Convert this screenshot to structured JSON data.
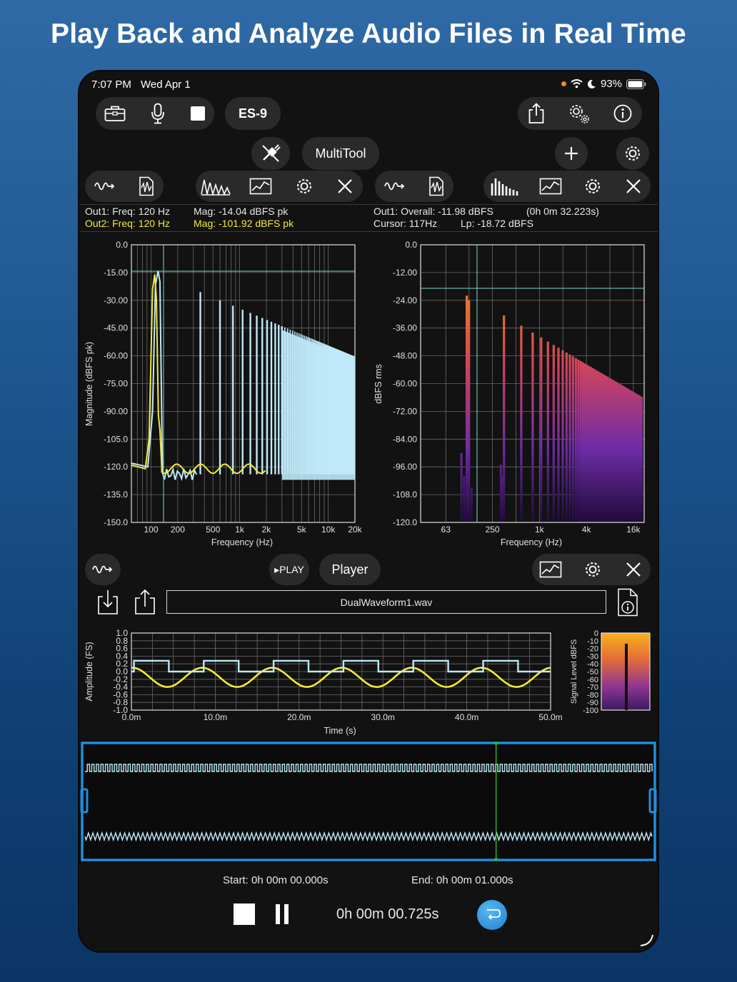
{
  "headline": "Play Back and Analyze Audio Files in Real Time",
  "status": {
    "time": "7:07 PM",
    "date": "Wed Apr 1",
    "battery": "93%"
  },
  "toolbar": {
    "device": "ES-9",
    "multitool": "MultiTool"
  },
  "fft": {
    "out1": "Out1:  Freq: 120 Hz",
    "out1_mag": "Mag: -14.04 dBFS pk",
    "out2": "Out2:  Freq: 120 Hz",
    "out2_mag": "Mag: -101.92 dBFS pk",
    "ylabel": "Magnitude (dBFS pk)",
    "xlabel": "Frequency (Hz)",
    "yticks": [
      "0.0",
      "-15.00",
      "-30.00",
      "-45.00",
      "-60.00",
      "-75.00",
      "-90.00",
      "-105.0",
      "-120.0",
      "-135.0",
      "-150.0"
    ],
    "xticks": [
      "100",
      "200",
      "500",
      "1k",
      "2k",
      "5k",
      "10k",
      "20k"
    ]
  },
  "rta": {
    "overall": "Out1:  Overall: -11.98 dBFS",
    "elapsed": "(0h  0m 32.223s)",
    "cursor": "Cursor: 117Hz",
    "lp": "Lp: -18.72 dBFS",
    "ylabel": "dBFS rms",
    "xlabel": "Frequency (Hz)",
    "yticks": [
      "0.0",
      "-12.00",
      "-24.00",
      "-36.00",
      "-48.00",
      "-60.00",
      "-72.00",
      "-84.00",
      "-96.00",
      "-108.0",
      "-120.0"
    ],
    "xticks": [
      "63",
      "250",
      "1k",
      "4k",
      "16k"
    ]
  },
  "player": {
    "play_label": "▸PLAY",
    "title": "Player",
    "filename": "DualWaveform1.wav",
    "start": "Start: 0h 00m 00.000s",
    "end": "End: 0h 00m 01.000s",
    "position": "0h 00m 00.725s",
    "progress_fraction": 0.725
  },
  "scope": {
    "ylabel": "Amplitude (FS)",
    "xlabel": "Time (s)",
    "yticks": [
      "1.0",
      "0.8",
      "0.6",
      "0.4",
      "0.2",
      "0.0",
      "-0.2",
      "-0.4",
      "-0.6",
      "-0.8",
      "-1.0"
    ],
    "xticks": [
      "0.0m",
      "10.0m",
      "20.0m",
      "30.0m",
      "40.0m",
      "50.0m"
    ]
  },
  "meter": {
    "ylabel": "Signal Level dBFS",
    "ticks": [
      "0",
      "-10",
      "-20",
      "-30",
      "-40",
      "-50",
      "-60",
      "-70",
      "-80",
      "-90",
      "-100"
    ]
  },
  "colors": {
    "out1": "#bfe9f8",
    "out2": "#f2ea3a",
    "accent": "#1e8fe0",
    "cursor": "#7fd6d0"
  }
}
